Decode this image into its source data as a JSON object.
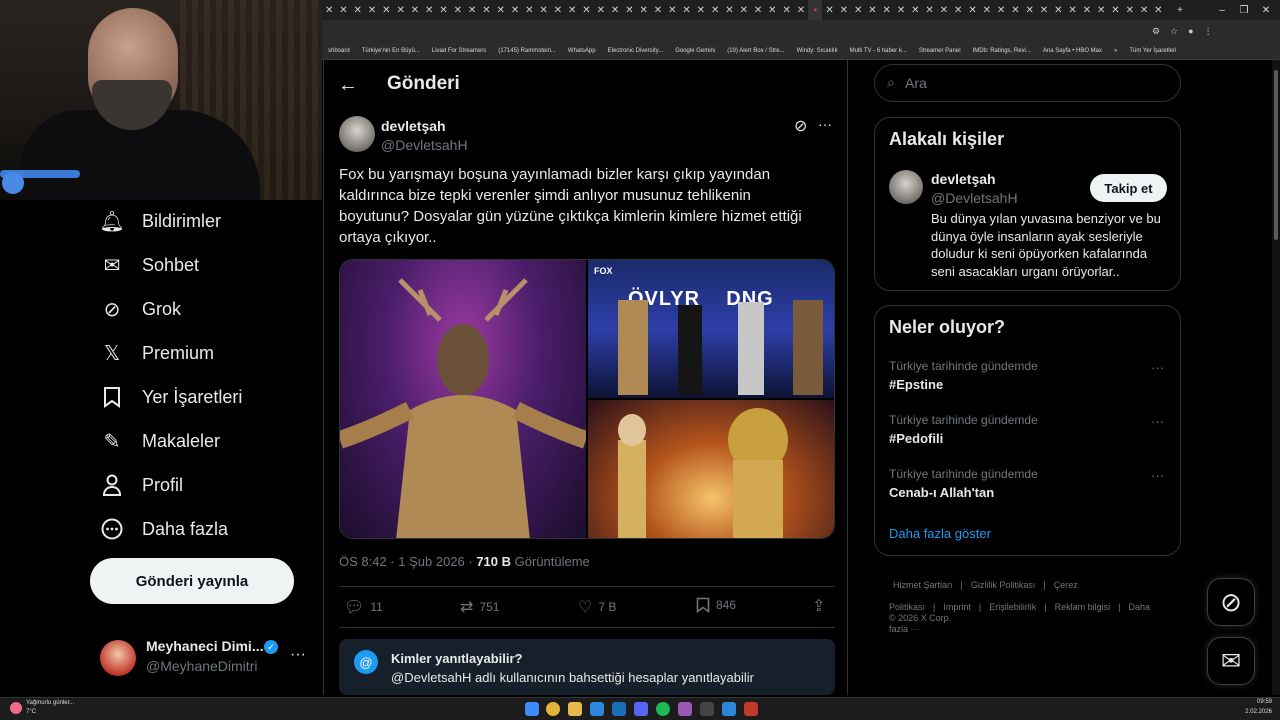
{
  "browser": {
    "bookmarks": [
      "shboard",
      "Türkiye'nin En Büyü...",
      "Livad For Streamers",
      "(17145) Rammstein...",
      "WhatsApp",
      "Electronic Diversity...",
      "Google Gemini",
      "(19) Alert Box / Stre...",
      "Windy: Sıcaklık",
      "Multi TV - 6 haber k...",
      "Streamer Panel",
      "IMDb: Ratings, Revi...",
      "Ana Sayfa • HBO Max",
      "»",
      "Tüm Yer İşaretleri"
    ]
  },
  "nav": {
    "items": [
      {
        "label": "Bildirimler",
        "icon": "bell-icon"
      },
      {
        "label": "Sohbet",
        "icon": "mail-icon"
      },
      {
        "label": "Grok",
        "icon": "grok-icon"
      },
      {
        "label": "Premium",
        "icon": "x-logo-icon"
      },
      {
        "label": "Yer İşaretleri",
        "icon": "bookmark-icon"
      },
      {
        "label": "Makaleler",
        "icon": "article-icon"
      },
      {
        "label": "Profil",
        "icon": "person-icon"
      },
      {
        "label": "Daha fazla",
        "icon": "more-circle-icon"
      }
    ],
    "post_button": "Gönderi yayınla",
    "account": {
      "name": "Meyhaneci Dimi...",
      "handle": "@MeyhaneDimitri"
    }
  },
  "header": {
    "title": "Gönderi"
  },
  "tweet": {
    "author_name": "devletşah",
    "author_handle": "@DevletsahH",
    "text": "Fox bu yarışmayı boşuna yayınlamadı bizler karşı çıkıp yayından kaldırınca bize tepki verenler şimdi anlıyor musunuz tehlikenin boyutunu? Dosyalar gün yüzüne çıktıkça kimlerin kimlere hizmet ettiği ortaya çıkıyor..",
    "meta_time": "ÖS 8:42 · 1 Şub 2026 · ",
    "views_count": "710 B",
    "views_label": " Görüntüleme",
    "replies": "11",
    "retweets": "751",
    "likes": "7 B",
    "bookmarks": "846",
    "image_fox_label": "FOX",
    "image_banner_text": "ÖVLYR    DNG",
    "reply_restriction_title": "Kimler yanıtlayabilir?",
    "reply_restriction_text": "@DevletsahH adlı kullanıcının bahsettiği hesaplar yanıtlayabilir"
  },
  "search": {
    "placeholder": "Ara"
  },
  "related": {
    "title": "Alakalı kişiler",
    "name": "devletşah",
    "handle": "@DevletsahH",
    "follow_label": "Takip et",
    "bio": "Bu dünya yılan yuvasına benziyor ve bu dünya öyle insanların ayak sesleriyle doludur ki seni öpüyorken kafalarında seni asacakları urganı örüyorlar.."
  },
  "trends": {
    "title": "Neler oluyor?",
    "items": [
      {
        "context": "Türkiye tarihinde gündemde",
        "name": "#Epstine"
      },
      {
        "context": "Türkiye tarihinde gündemde",
        "name": "#Pedofili"
      },
      {
        "context": "Türkiye tarihinde gündemde",
        "name": "Cenab-ı Allah'tan"
      }
    ],
    "show_more": "Daha fazla göster"
  },
  "footer": {
    "links": [
      "Hizmet Şartları",
      "|",
      "Gizlilik Politikası",
      "|",
      "Çerez Politikası",
      "|",
      "Imprint",
      "|",
      "Erişilebilirlik",
      "|",
      "Reklam bilgisi",
      "|",
      "Daha fazla ···"
    ],
    "copyright": "© 2026 X Corp."
  },
  "taskbar": {
    "weather": "Yağmurlu günler...",
    "temp": "7°C",
    "time": "09:59",
    "date": "2.02.2026"
  },
  "colors": {
    "accent": "#1d9bf0",
    "background": "#000000",
    "border": "#2f3336",
    "muted": "#71767b"
  }
}
